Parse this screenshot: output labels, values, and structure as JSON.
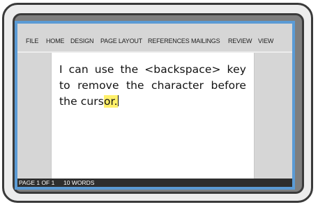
{
  "menu": {
    "items": [
      {
        "label": "FILE"
      },
      {
        "label": "HOME"
      },
      {
        "label": "DESIGN"
      },
      {
        "label": "PAGE LAYOUT"
      },
      {
        "label": "REFERENCES"
      },
      {
        "label": "MAILINGS"
      },
      {
        "label": "REVIEW"
      },
      {
        "label": "VIEW"
      }
    ]
  },
  "document": {
    "text_main": "I can use the <backspace> key to remove the character before the curs",
    "text_highlight": "or."
  },
  "status": {
    "page": "PAGE 1 OF 1",
    "words": "10 WORDS"
  },
  "colors": {
    "screen_border": "#5b9bd5",
    "highlight": "#fff06a",
    "status_bar": "#2e2e2e"
  }
}
